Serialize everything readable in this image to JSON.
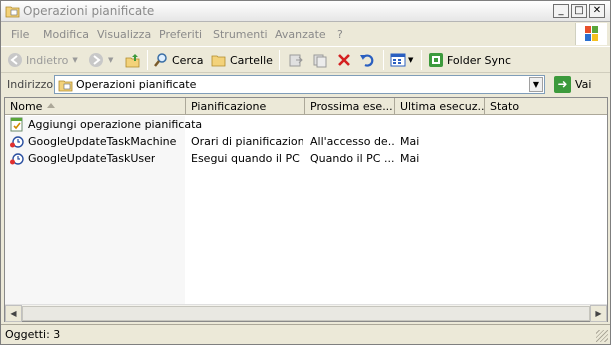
{
  "window": {
    "title": "Operazioni pianificate"
  },
  "menu": [
    "File",
    "Modifica",
    "Visualizza",
    "Preferiti",
    "Strumenti",
    "Avanzate",
    "?"
  ],
  "toolbar": {
    "back_label": "Indietro",
    "search_label": "Cerca",
    "folders_label": "Cartelle",
    "folder_sync_label": "Folder Sync"
  },
  "address": {
    "label": "Indirizzo",
    "value": "Operazioni pianificate",
    "go_label": "Vai"
  },
  "columns": [
    "Nome",
    "Pianificazione",
    "Prossima ese...",
    "Ultima esecuz...",
    "Stato"
  ],
  "rows": [
    {
      "name": "Aggiungi operazione pianificata",
      "schedule": "",
      "next": "",
      "last": "",
      "status": "",
      "icon": "add-task-icon"
    },
    {
      "name": "GoogleUpdateTaskMachine",
      "schedule": "Orari di pianificazione...",
      "next": "All'accesso de...",
      "last": "Mai",
      "status": "",
      "icon": "scheduled-task-icon"
    },
    {
      "name": "GoogleUpdateTaskUser",
      "schedule": "Esegui quando il PC ...",
      "next": "Quando il PC ...",
      "last": "Mai",
      "status": "",
      "icon": "scheduled-task-icon"
    }
  ],
  "status": {
    "text": "Oggetti: 3"
  }
}
